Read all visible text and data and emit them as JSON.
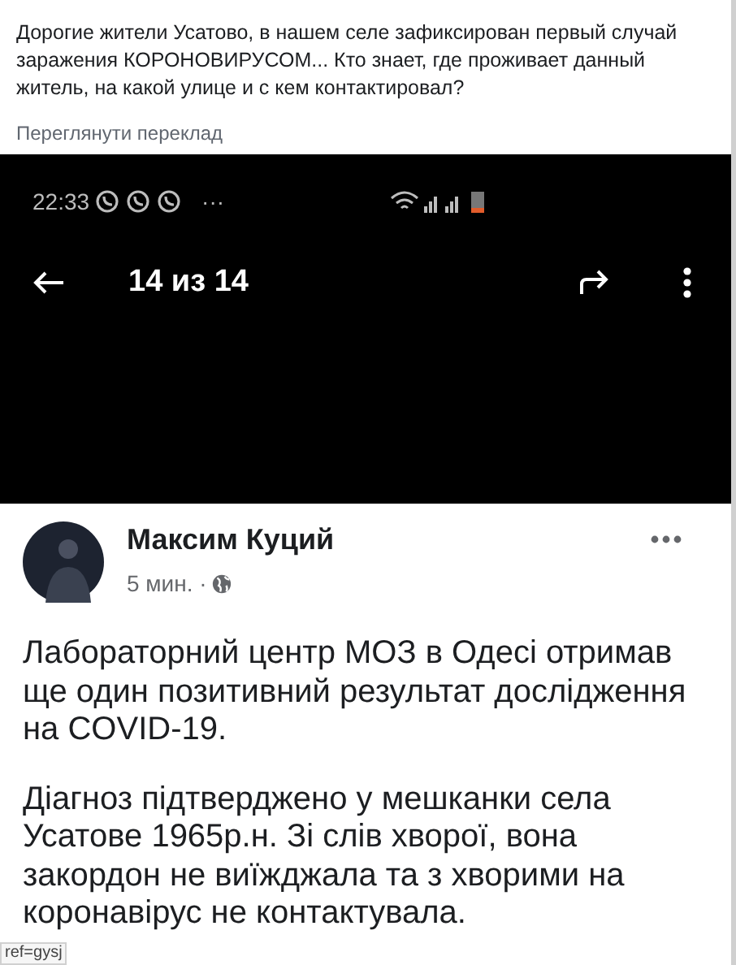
{
  "post": {
    "text": "Дорогие жители Усатово, в нашем селе зафиксирован первый случай заражения КОРОНОВИРУСОМ... Кто знает, где проживает данный житель, на какой улице и с кем контактировал?",
    "translate_link": "Переглянути переклад"
  },
  "phone_screenshot": {
    "status_bar": {
      "time": "22:33",
      "more": "···"
    },
    "viewer": {
      "counter": "14 из 14"
    },
    "author": {
      "name": "Максим Куций",
      "time": "5 мин. ·"
    },
    "paragraphs": [
      {
        "lines": [
          "Лабораторний центр МОЗ в Одесі отримав",
          "ще один позитивний результат дослідження",
          "на COVID-19."
        ]
      },
      {
        "lines": [
          "Діагноз підтверджено у мешканки села",
          "Усатове 1965р.н. Зі слів хворої, вона",
          "закордон не виїжджала та з хворими на",
          "коронавірус не контактувала."
        ]
      }
    ]
  },
  "browser_status": {
    "url": "ref=gysj"
  }
}
